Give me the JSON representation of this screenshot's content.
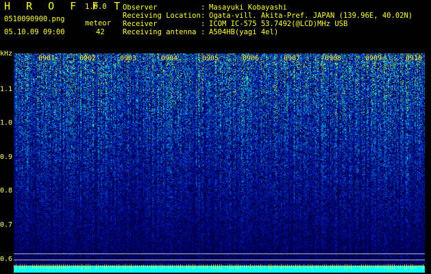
{
  "app": {
    "title": "H R O F F T",
    "version": "1.0.0"
  },
  "file": {
    "name": "0510090900.png",
    "datetime": "05.10.09 09:00"
  },
  "meteor": {
    "label": "meteor",
    "count": "42"
  },
  "metadata": [
    {
      "label": "Observer",
      "value": "Masayuki Kobayashi"
    },
    {
      "label": "Receiving Location",
      "value": "Ogata-vill. Akita-Pref. JAPAN (139.96E, 40.02N)"
    },
    {
      "label": "Receiver",
      "value": "ICOM IC-575 53.7492(@LCD)MHz USB"
    },
    {
      "label": "Receiving antenna",
      "value": "A504HB(yagi 4el)"
    }
  ],
  "separator": ":",
  "axes": {
    "y_unit": "kHz",
    "y_ticks": [
      "1.1",
      "1.0",
      "0.9",
      "0.8",
      "0.7",
      "0.6"
    ],
    "x_ticks": [
      "0901",
      "0902",
      "0903",
      "0904",
      "0905",
      "0906",
      "0907",
      "0908",
      "0909",
      "0910"
    ]
  },
  "colors": {
    "text": "#ffff33",
    "background": "#000000",
    "baseline": "#00ffff"
  }
}
